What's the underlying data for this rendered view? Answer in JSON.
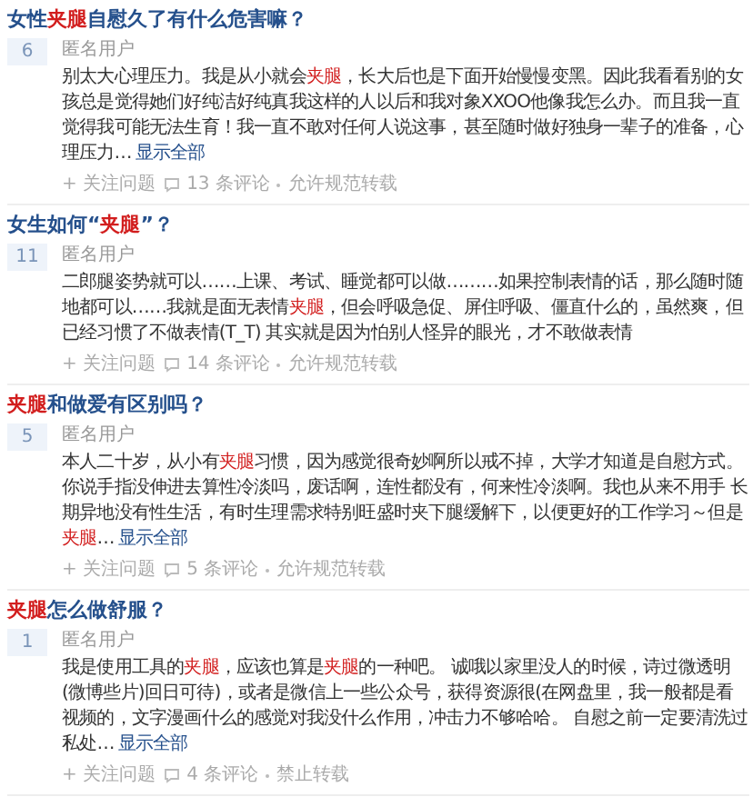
{
  "questions": [
    {
      "title": [
        {
          "text": "女性",
          "highlight": false
        },
        {
          "text": "夹腿",
          "highlight": true
        },
        {
          "text": "自慰久了有什么危害嘛？",
          "highlight": false
        }
      ],
      "votes": "6",
      "author": "匿名用户",
      "answer": [
        {
          "text": "别太大心理压力。我是从小就会",
          "highlight": false
        },
        {
          "text": "夹腿",
          "highlight": true
        },
        {
          "text": "，长大后也是下面开始慢慢变黑。因此我看看别的女孩总是觉得她们好纯洁好纯真我这样的人以后和我对象XXOO他像我怎么办。而且我一直觉得我可能无法生育！我一直不敢对任何人说这事，甚至随时做好独身一辈子的准备，心理压力…",
          "highlight": false
        }
      ],
      "more": "显示全部",
      "follow": "+ 关注问题",
      "comments": "13 条评论",
      "repost": "允许规范转载"
    },
    {
      "title": [
        {
          "text": "女生如何“",
          "highlight": false
        },
        {
          "text": "夹腿",
          "highlight": true
        },
        {
          "text": "”？",
          "highlight": false
        }
      ],
      "votes": "11",
      "author": "匿名用户",
      "answer": [
        {
          "text": "二郎腿姿势就可以……上课、考试、睡觉都可以做………如果控制表情的话，那么随时随地都可以……我就是面无表情",
          "highlight": false
        },
        {
          "text": "夹腿",
          "highlight": true
        },
        {
          "text": "，但会呼吸急促、屏住呼吸、僵直什么的，虽然爽，但已经习惯了不做表情(T_T) 其实就是因为怕别人怪异的眼光，才不敢做表情",
          "highlight": false
        }
      ],
      "follow": "+ 关注问题",
      "comments": "14 条评论",
      "repost": "允许规范转载"
    },
    {
      "title": [
        {
          "text": "夹腿",
          "highlight": true
        },
        {
          "text": "和做爱有区别吗？",
          "highlight": false
        }
      ],
      "votes": "5",
      "author": "匿名用户",
      "answer": [
        {
          "text": "本人二十岁，从小有",
          "highlight": false
        },
        {
          "text": "夹腿",
          "highlight": true
        },
        {
          "text": "习惯，因为感觉很奇妙啊所以戒不掉，大学才知道是自慰方式。你说手指没伸进去算性冷淡吗，废话啊，连性都没有，何来性冷淡啊。我也从来不用手 长期异地没有性生活，有时生理需求特别旺盛时夹下腿缓解下，以便更好的工作学习～但是",
          "highlight": false
        },
        {
          "text": "夹腿",
          "highlight": true
        },
        {
          "text": "…",
          "highlight": false
        }
      ],
      "more": "显示全部",
      "follow": "+ 关注问题",
      "comments": "5 条评论",
      "repost": "允许规范转载"
    },
    {
      "title": [
        {
          "text": "夹腿",
          "highlight": true
        },
        {
          "text": "怎么做舒服？",
          "highlight": false
        }
      ],
      "votes": "1",
      "author": "匿名用户",
      "answer": [
        {
          "text": "我是使用工具的",
          "highlight": false
        },
        {
          "text": "夹腿",
          "highlight": true
        },
        {
          "text": "，应该也算是",
          "highlight": false
        },
        {
          "text": "夹腿",
          "highlight": true
        },
        {
          "text": "的一种吧。 诚哦以家里没人的时候，诗过微透明(微博些片)回日可待)，或者是微信上一些公众号，获得资源很(在网盘里，我一般都是看视频的，文字漫画什么的感觉对我没什么作用，冲击力不够哈哈。 自慰之前一定要清洗过私处…",
          "highlight": false
        }
      ],
      "more": "显示全部",
      "follow": "+ 关注问题",
      "comments": "4 条评论",
      "repost": "禁止转载"
    }
  ]
}
